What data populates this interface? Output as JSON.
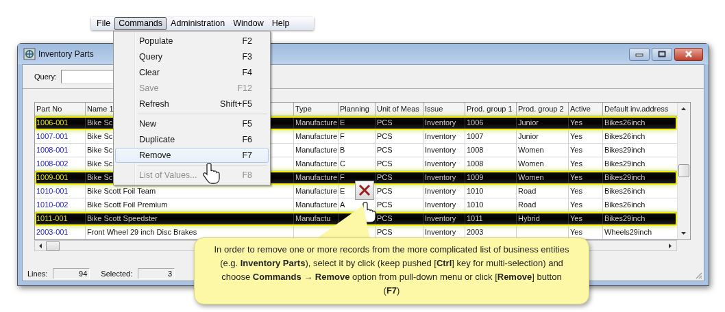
{
  "menu_bar": [
    {
      "label": "File",
      "selected": false
    },
    {
      "label": "Commands",
      "selected": true
    },
    {
      "label": "Administration",
      "selected": false
    },
    {
      "label": "Window",
      "selected": false
    },
    {
      "label": "Help",
      "selected": false
    }
  ],
  "commands_menu": [
    {
      "kind": "item",
      "label": "Populate",
      "shortcut": "F2",
      "disabled": false,
      "selected": false
    },
    {
      "kind": "item",
      "label": "Query",
      "shortcut": "F3",
      "disabled": false,
      "selected": false
    },
    {
      "kind": "item",
      "label": "Clear",
      "shortcut": "F4",
      "disabled": false,
      "selected": false
    },
    {
      "kind": "item",
      "label": "Save",
      "shortcut": "F12",
      "disabled": true,
      "selected": false
    },
    {
      "kind": "item",
      "label": "Refresh",
      "shortcut": "Shift+F5",
      "disabled": false,
      "selected": false
    },
    {
      "kind": "separator"
    },
    {
      "kind": "item",
      "label": "New",
      "shortcut": "F5",
      "disabled": false,
      "selected": false
    },
    {
      "kind": "item",
      "label": "Duplicate",
      "shortcut": "F6",
      "disabled": false,
      "selected": false
    },
    {
      "kind": "item",
      "label": "Remove",
      "shortcut": "F7",
      "disabled": false,
      "selected": true
    },
    {
      "kind": "separator"
    },
    {
      "kind": "item",
      "label": "List of Values...",
      "shortcut": "F8",
      "disabled": true,
      "selected": false
    }
  ],
  "window": {
    "title": "Inventory Parts"
  },
  "query": {
    "label": "Query:"
  },
  "table": {
    "columns": [
      "Part No",
      "Name 1",
      "Type",
      "Planning",
      "Unit of Meas",
      "Issue",
      "Prod. group 1",
      "Prod. group 2",
      "Active",
      "Default inv.address"
    ],
    "rows": [
      {
        "selected": true,
        "cells": [
          "1006-001",
          "Bike Sc",
          "Manufacture",
          "E",
          "PCS",
          "Inventory",
          "1006",
          "Junior",
          "Yes",
          "Bikes26inch"
        ]
      },
      {
        "selected": false,
        "cells": [
          "1007-001",
          "Bike Sc",
          "Manufacture",
          "F",
          "PCS",
          "Inventory",
          "1007",
          "Junior",
          "Yes",
          "Bikes26inch"
        ]
      },
      {
        "selected": false,
        "cells": [
          "1008-001",
          "Bike Sc",
          "Manufacture",
          "B",
          "PCS",
          "Inventory",
          "1008",
          "Women",
          "Yes",
          "Bikes29inch"
        ]
      },
      {
        "selected": false,
        "cells": [
          "1008-002",
          "Bike Sc",
          "Manufacture",
          "C",
          "PCS",
          "Inventory",
          "1008",
          "Women",
          "Yes",
          "Bikes29inch"
        ]
      },
      {
        "selected": true,
        "cells": [
          "1009-001",
          "Bike Sc",
          "Manufacture",
          "F",
          "PCS",
          "Inventory",
          "1009",
          "Women",
          "Yes",
          "Bikes29inch"
        ]
      },
      {
        "selected": false,
        "cells": [
          "1010-001",
          "Bike Scott Foil Team",
          "Manufacture",
          "E",
          "PCS",
          "Inventory",
          "1010",
          "Road",
          "Yes",
          "Bikes26inch"
        ]
      },
      {
        "selected": false,
        "cells": [
          "1010-002",
          "Bike Scott Foil Premium",
          "Manufacture",
          "A",
          "PCS",
          "Inventory",
          "1010",
          "Road",
          "Yes",
          "Bikes26inch"
        ]
      },
      {
        "selected": true,
        "cells": [
          "1011-001",
          "Bike Scott Speedster",
          "Manufactu",
          null,
          "PCS",
          "Inventory",
          "1011",
          "Hybrid",
          "Yes",
          "Bikes29inch"
        ]
      },
      {
        "selected": false,
        "cells": [
          "2003-001",
          "Front Wheel 29 inch Disc Brakes",
          null,
          null,
          "PCS",
          "Inventory",
          "2003",
          null,
          "Yes",
          "Wheels29inch"
        ]
      }
    ]
  },
  "status_bar": {
    "lines_label": "Lines:",
    "lines": "94",
    "selected_label": "Selected:",
    "selected": "3"
  },
  "callout": {
    "text": "In order to remove one or more records from the more complicated list of business entities (e.g. **Inventory Parts**), select it by click (keep pushed [**Ctrl**] key for multi-selection) and choose **Commands** → **Remove** option from pull-down menu or click [**Remove**] button (**F7**)"
  }
}
